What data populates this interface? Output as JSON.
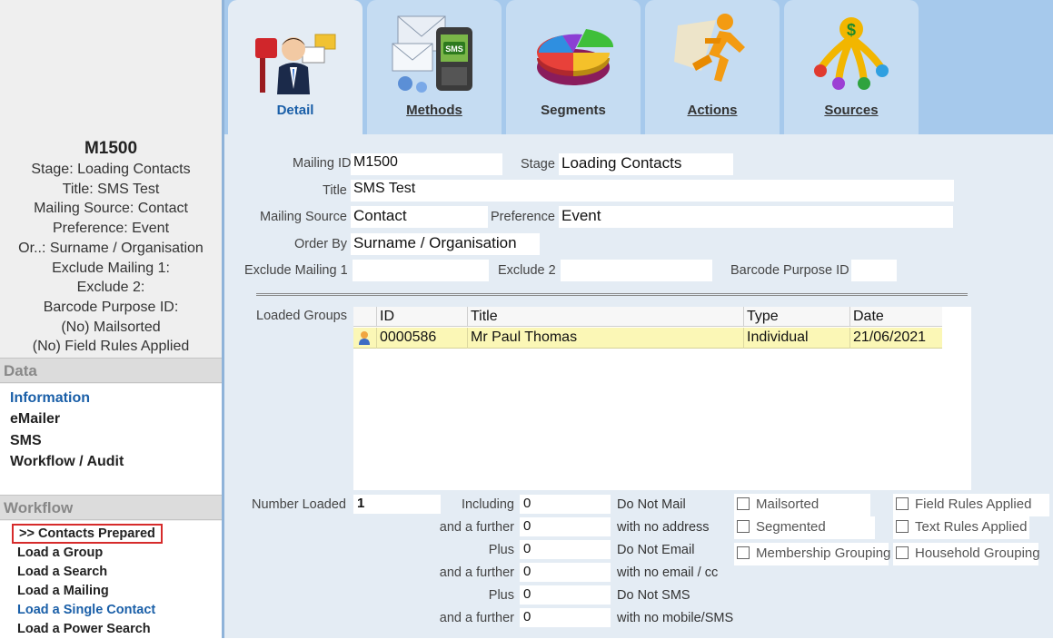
{
  "summary": {
    "code": "M1500",
    "lines": [
      "Stage: Loading Contacts",
      "Title: SMS Test",
      "Mailing Source: Contact",
      "Preference: Event",
      "Or..: Surname / Organisation",
      "Exclude Mailing 1:",
      "Exclude 2:",
      "Barcode Purpose ID:",
      "(No) Mailsorted",
      "(No) Field Rules Applied"
    ]
  },
  "data_section": {
    "heading": "Data",
    "items": [
      "Information",
      "eMailer",
      "SMS",
      "Workflow / Audit"
    ]
  },
  "workflow_section": {
    "heading": "Workflow",
    "current": ">> Contacts Prepared",
    "items": [
      "Load a Group",
      "Load a Search",
      "Load a Mailing",
      "Load a Single Contact",
      "Load a Power Search"
    ]
  },
  "tabs": [
    {
      "label": "Detail",
      "icon": "mailbox-person-icon"
    },
    {
      "label": "Methods",
      "icon": "email-sms-icon"
    },
    {
      "label": "Segments",
      "icon": "pie-chart-icon"
    },
    {
      "label": "Actions",
      "icon": "running-man-icon"
    },
    {
      "label": "Sources",
      "icon": "money-tree-icon"
    }
  ],
  "form": {
    "mailing_id_label": "Mailing ID",
    "mailing_id": "M1500",
    "stage_label": "Stage",
    "stage": "Loading Contacts",
    "title_label": "Title",
    "title": "SMS Test",
    "mailing_source_label": "Mailing Source",
    "mailing_source": "Contact",
    "preference_label": "Preference",
    "preference": "Event",
    "order_by_label": "Order By",
    "order_by": "Surname / Organisation",
    "exclude_mailing_1_label": "Exclude Mailing 1",
    "exclude_mailing_1": "",
    "exclude_2_label": "Exclude 2",
    "exclude_2": "",
    "barcode_purpose_id_label": "Barcode Purpose ID",
    "barcode_purpose_id": ""
  },
  "loaded_groups": {
    "label": "Loaded Groups",
    "columns": [
      "ID",
      "Title",
      "Type",
      "Date"
    ],
    "rows": [
      {
        "id": "0000586",
        "title": "Mr Paul Thomas",
        "type": "Individual",
        "date": "21/06/2021"
      }
    ]
  },
  "counts": {
    "number_loaded_label": "Number Loaded",
    "number_loaded": "1",
    "rows": [
      {
        "label": "Including",
        "value": "0",
        "desc": "Do Not Mail"
      },
      {
        "label": "and a further",
        "value": "0",
        "desc": "with no address"
      },
      {
        "label": "Plus",
        "value": "0",
        "desc": "Do Not Email"
      },
      {
        "label": "and a further",
        "value": "0",
        "desc": "with no email / cc"
      },
      {
        "label": "Plus",
        "value": "0",
        "desc": "Do Not SMS"
      },
      {
        "label": "and a further",
        "value": "0",
        "desc": "with no mobile/SMS"
      }
    ]
  },
  "checkboxes": {
    "left": [
      "Mailsorted",
      "Segmented",
      "Membership Grouping"
    ],
    "right": [
      "Field Rules Applied",
      "Text Rules Applied",
      "Household Grouping"
    ]
  },
  "colors": {
    "accent": "#1a5fa8",
    "highlight_border": "#d62b2b",
    "selected_row": "#fbf7b6",
    "panel_blue": "#a6c9ec"
  }
}
